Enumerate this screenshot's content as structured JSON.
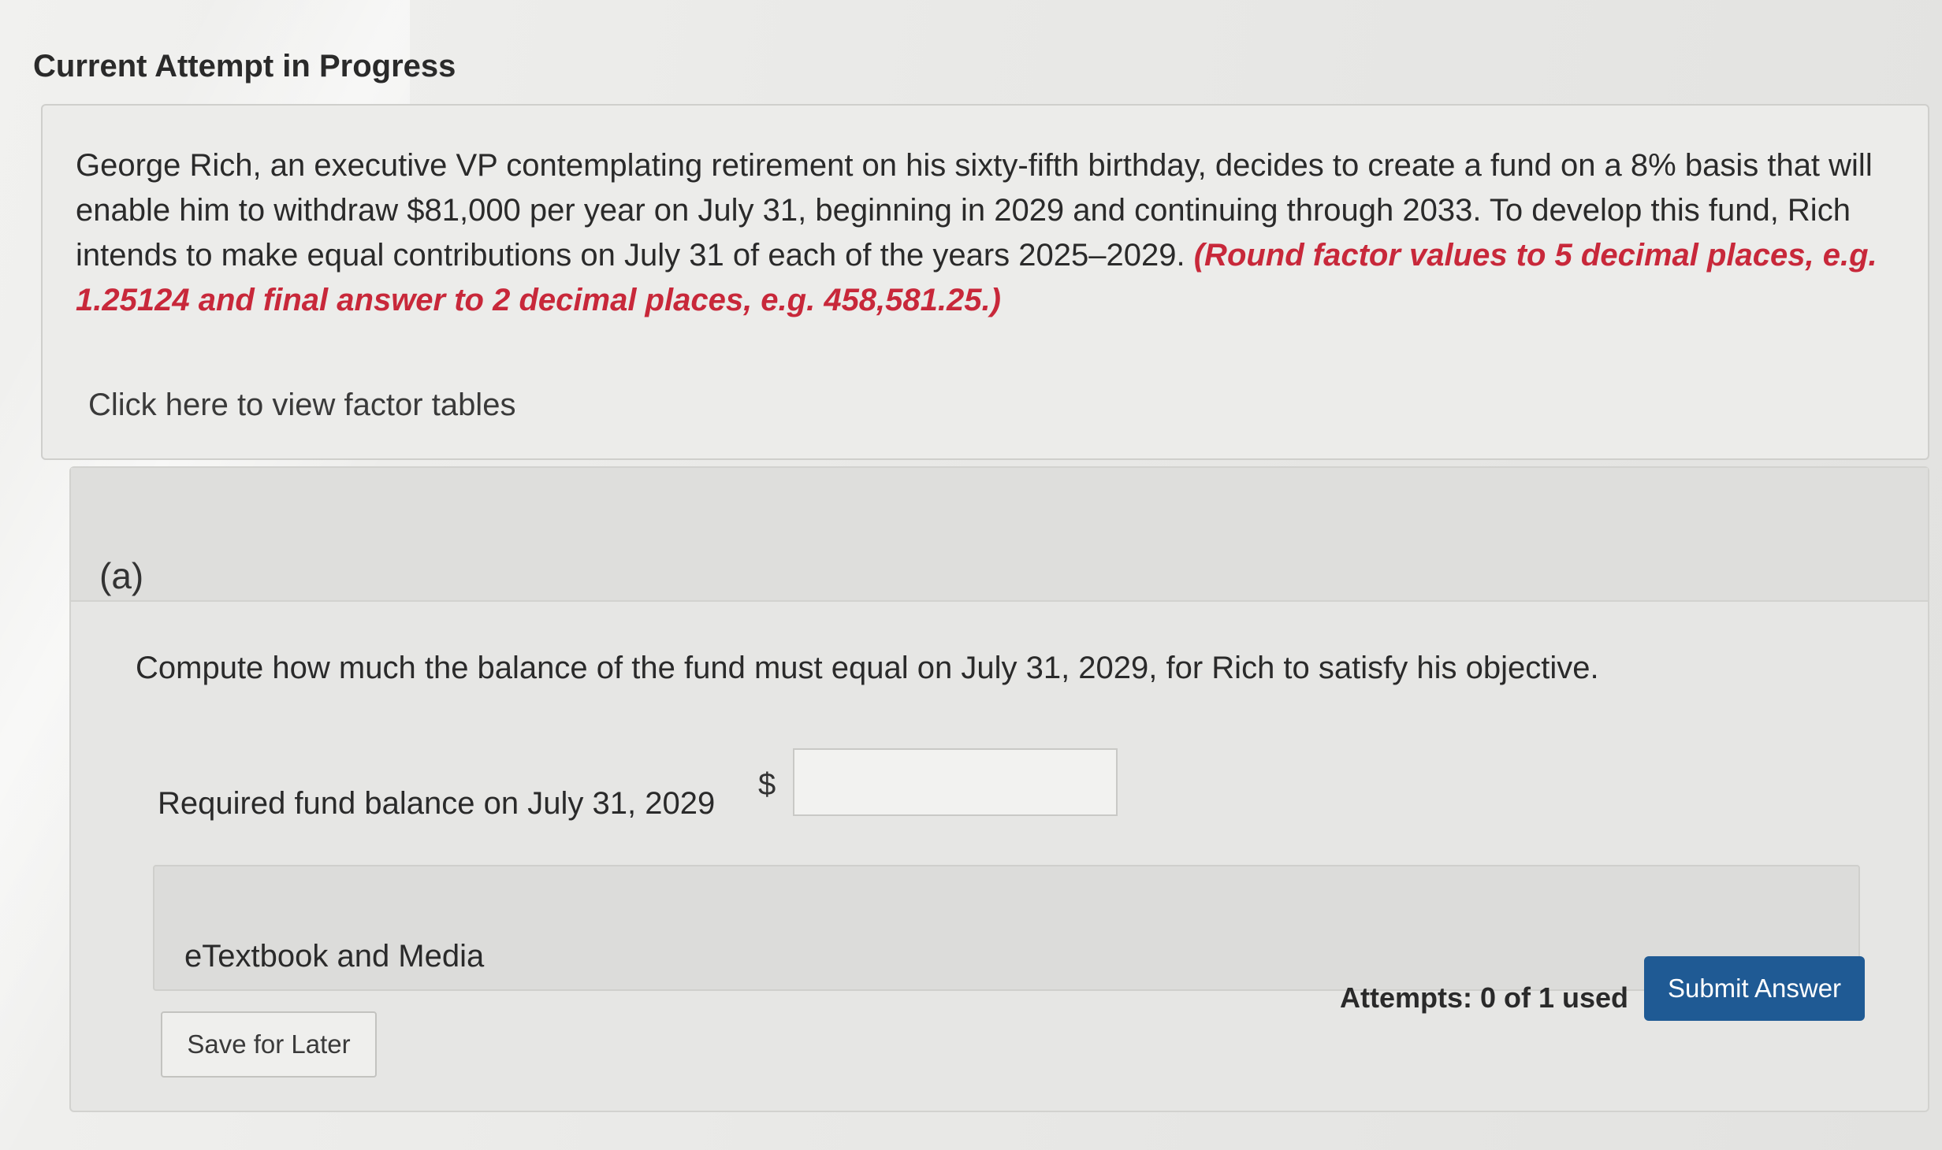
{
  "header": {
    "title": "Current Attempt in Progress"
  },
  "question": {
    "text": "George Rich, an executive VP contemplating retirement on his sixty-fifth birthday, decides to create a fund on a 8% basis that will enable him to withdraw $81,000 per year on July 31, beginning in 2029 and continuing through 2033. To develop this fund, Rich intends to make equal contributions on July 31 of each of the years 2025–2029. ",
    "instruction": "(Round factor values to 5 decimal places, e.g. 1.25124 and final answer to 2 decimal places, e.g. 458,581.25.)",
    "factor_link": "Click here to view factor tables"
  },
  "part": {
    "label": "(a)",
    "prompt": "Compute how much the balance of the fund must equal on July 31, 2029, for Rich to satisfy his objective.",
    "fund_label": "Required fund balance on July 31, 2029",
    "currency": "$",
    "answer_value": "",
    "etextbook_label": "eTextbook and Media",
    "save_label": "Save for Later",
    "attempts_text": "Attempts: 0 of 1 used",
    "submit_label": "Submit Answer"
  },
  "colors": {
    "instruction": "#c8283a",
    "submit_bg": "#1f5a94"
  }
}
